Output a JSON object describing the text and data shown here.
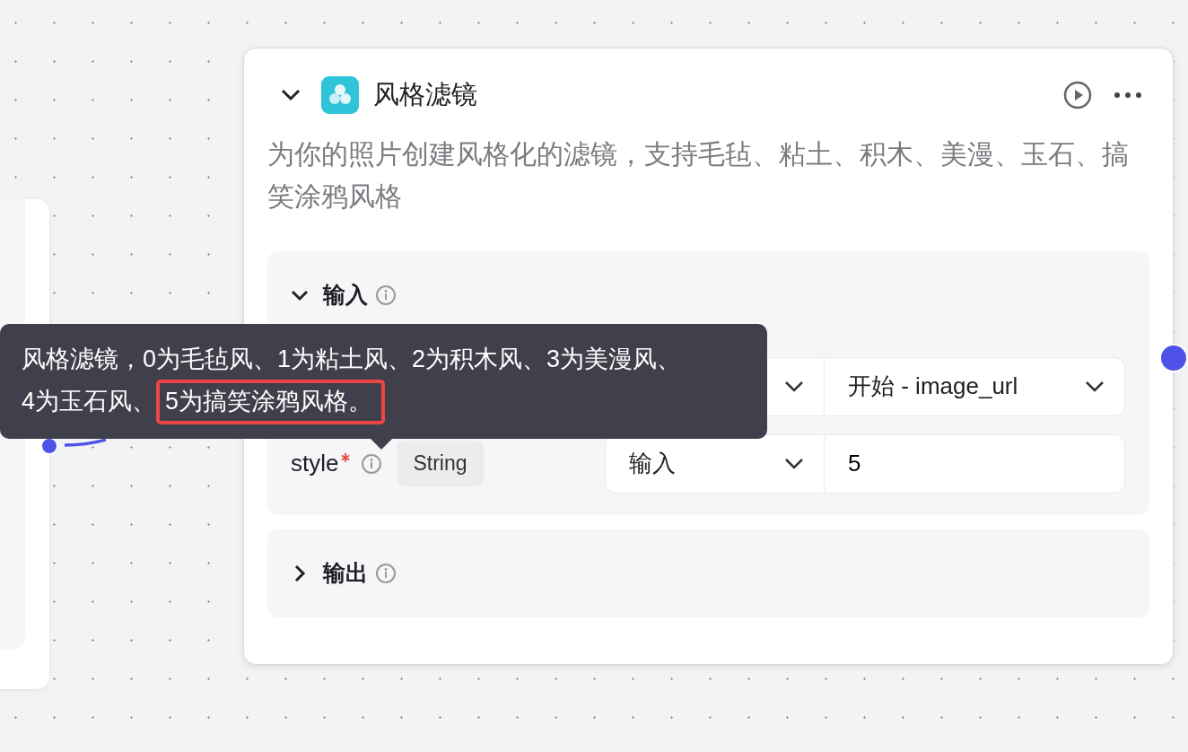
{
  "node": {
    "title": "风格滤镜",
    "description": "为你的照片创建风格化的滤镜，支持毛毡、粘土、积木、美漫、玉石、搞笑涂鸦风格",
    "expanded": true
  },
  "input_section": {
    "title": "输入",
    "expanded": true,
    "rows": [
      {
        "kind": "select",
        "value": "开始 - image_url"
      },
      {
        "kind": "input",
        "name": "style",
        "required": true,
        "type": "String",
        "source": "输入",
        "value": "5"
      }
    ]
  },
  "output_section": {
    "title": "输出",
    "expanded": false
  },
  "tooltip": {
    "text": "风格滤镜，0为毛毡风、1为粘土风、2为积木风、3为美漫风、4为玉石风、",
    "highlighted": "5为搞笑涂鸦风格。"
  }
}
